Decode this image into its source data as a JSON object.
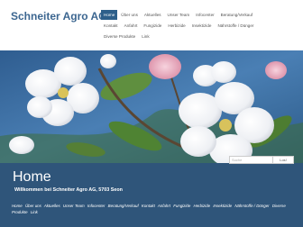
{
  "site": {
    "brand": "Schneiter Agro AG"
  },
  "nav": {
    "row1": [
      "Home",
      "Über uns",
      "Aktuelles",
      "Unser Team",
      "Infocenter",
      "Beratung/Verkauf"
    ],
    "row2": [
      "Kontakt",
      "Anfahrt",
      "Fungizide",
      "Herbizide",
      "Insektizide",
      "Nährstoffe / Dünger"
    ],
    "row3": [
      "Diverse Produkte",
      "Link"
    ]
  },
  "search": {
    "placeholder": "Suche",
    "button": "Los!"
  },
  "main": {
    "title": "Home",
    "welcome": "Willkommen bei Schneiter Agro AG,  5703 Seon"
  },
  "footer_nav": [
    "Home",
    "Über uns",
    "Aktuelles",
    "Unser Team",
    "Infocenter",
    "Beratung/Verkauf",
    "Kontakt",
    "Anfahrt",
    "Fungizide",
    "Herbizide",
    "Insektizide",
    "Nährstoffe / Dünger",
    "Diverse Produkte",
    "Link"
  ],
  "colors": {
    "accent": "#2d5f8a",
    "content_bg": "#2f557a",
    "brand_text": "#3c6690"
  }
}
